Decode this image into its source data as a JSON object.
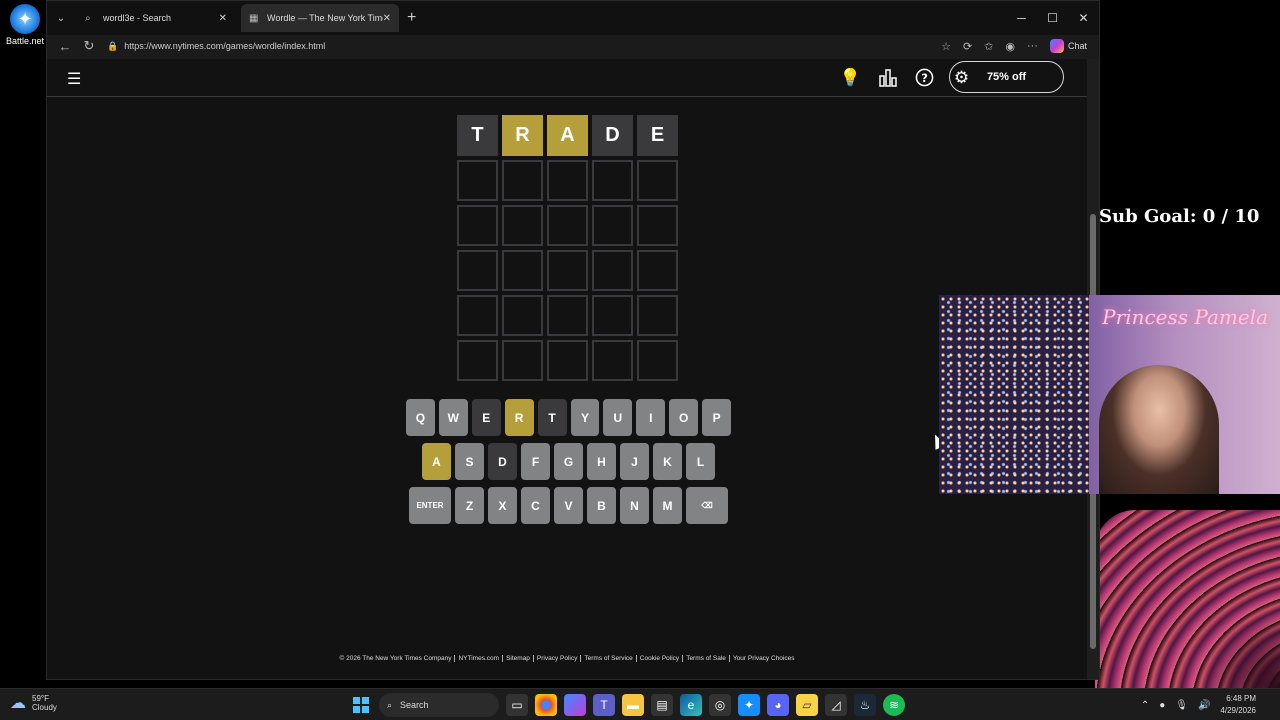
{
  "desktop": {
    "battlenet_label": "Battle.net"
  },
  "browser": {
    "tabs": [
      {
        "title": "wordl3e - Search",
        "icon": "search-icon"
      },
      {
        "title": "Wordle — The New York Times",
        "icon": "nyt-grid-icon"
      }
    ],
    "url": "https://www.nytimes.com/games/wordle/index.html",
    "chat_label": "Chat"
  },
  "wordle": {
    "sale_label": "75% off",
    "header_icons": [
      "lightbulb-icon",
      "stats-icon",
      "help-icon",
      "settings-icon"
    ],
    "guess": [
      {
        "letter": "T",
        "state": "absent"
      },
      {
        "letter": "R",
        "state": "present"
      },
      {
        "letter": "A",
        "state": "present"
      },
      {
        "letter": "D",
        "state": "absent"
      },
      {
        "letter": "E",
        "state": "absent"
      }
    ],
    "rows_total": 6,
    "keyboard": [
      [
        {
          "k": "Q",
          "s": ""
        },
        {
          "k": "W",
          "s": ""
        },
        {
          "k": "E",
          "s": "absent"
        },
        {
          "k": "R",
          "s": "present"
        },
        {
          "k": "T",
          "s": "absent"
        },
        {
          "k": "Y",
          "s": ""
        },
        {
          "k": "U",
          "s": ""
        },
        {
          "k": "I",
          "s": ""
        },
        {
          "k": "O",
          "s": ""
        },
        {
          "k": "P",
          "s": ""
        }
      ],
      [
        {
          "k": "A",
          "s": "present"
        },
        {
          "k": "S",
          "s": ""
        },
        {
          "k": "D",
          "s": "absent"
        },
        {
          "k": "F",
          "s": ""
        },
        {
          "k": "G",
          "s": ""
        },
        {
          "k": "H",
          "s": ""
        },
        {
          "k": "J",
          "s": ""
        },
        {
          "k": "K",
          "s": ""
        },
        {
          "k": "L",
          "s": ""
        }
      ],
      [
        {
          "k": "ENTER",
          "s": "",
          "wide": true
        },
        {
          "k": "Z",
          "s": ""
        },
        {
          "k": "X",
          "s": ""
        },
        {
          "k": "C",
          "s": ""
        },
        {
          "k": "V",
          "s": ""
        },
        {
          "k": "B",
          "s": ""
        },
        {
          "k": "N",
          "s": ""
        },
        {
          "k": "M",
          "s": ""
        },
        {
          "k": "⌫",
          "s": "",
          "wide": true
        }
      ]
    ],
    "footer_links": [
      "© 2026 The New York Times Company",
      "NYTimes.com",
      "Sitemap",
      "Privacy Policy",
      "Terms of Service",
      "Cookie Policy",
      "Terms of Sale",
      "Your Privacy Choices"
    ],
    "colors": {
      "present": "#b59f3b",
      "absent": "#3a3a3c",
      "unused": "#818384"
    }
  },
  "overlay": {
    "sub_goal": "Sub Goal: 0 / 10",
    "neon_sign": "Princess Pamela"
  },
  "taskbar": {
    "temperature": "59°F",
    "condition": "Cloudy",
    "search_label": "Search",
    "time": "6:48 PM",
    "date": "4/29/2026"
  }
}
